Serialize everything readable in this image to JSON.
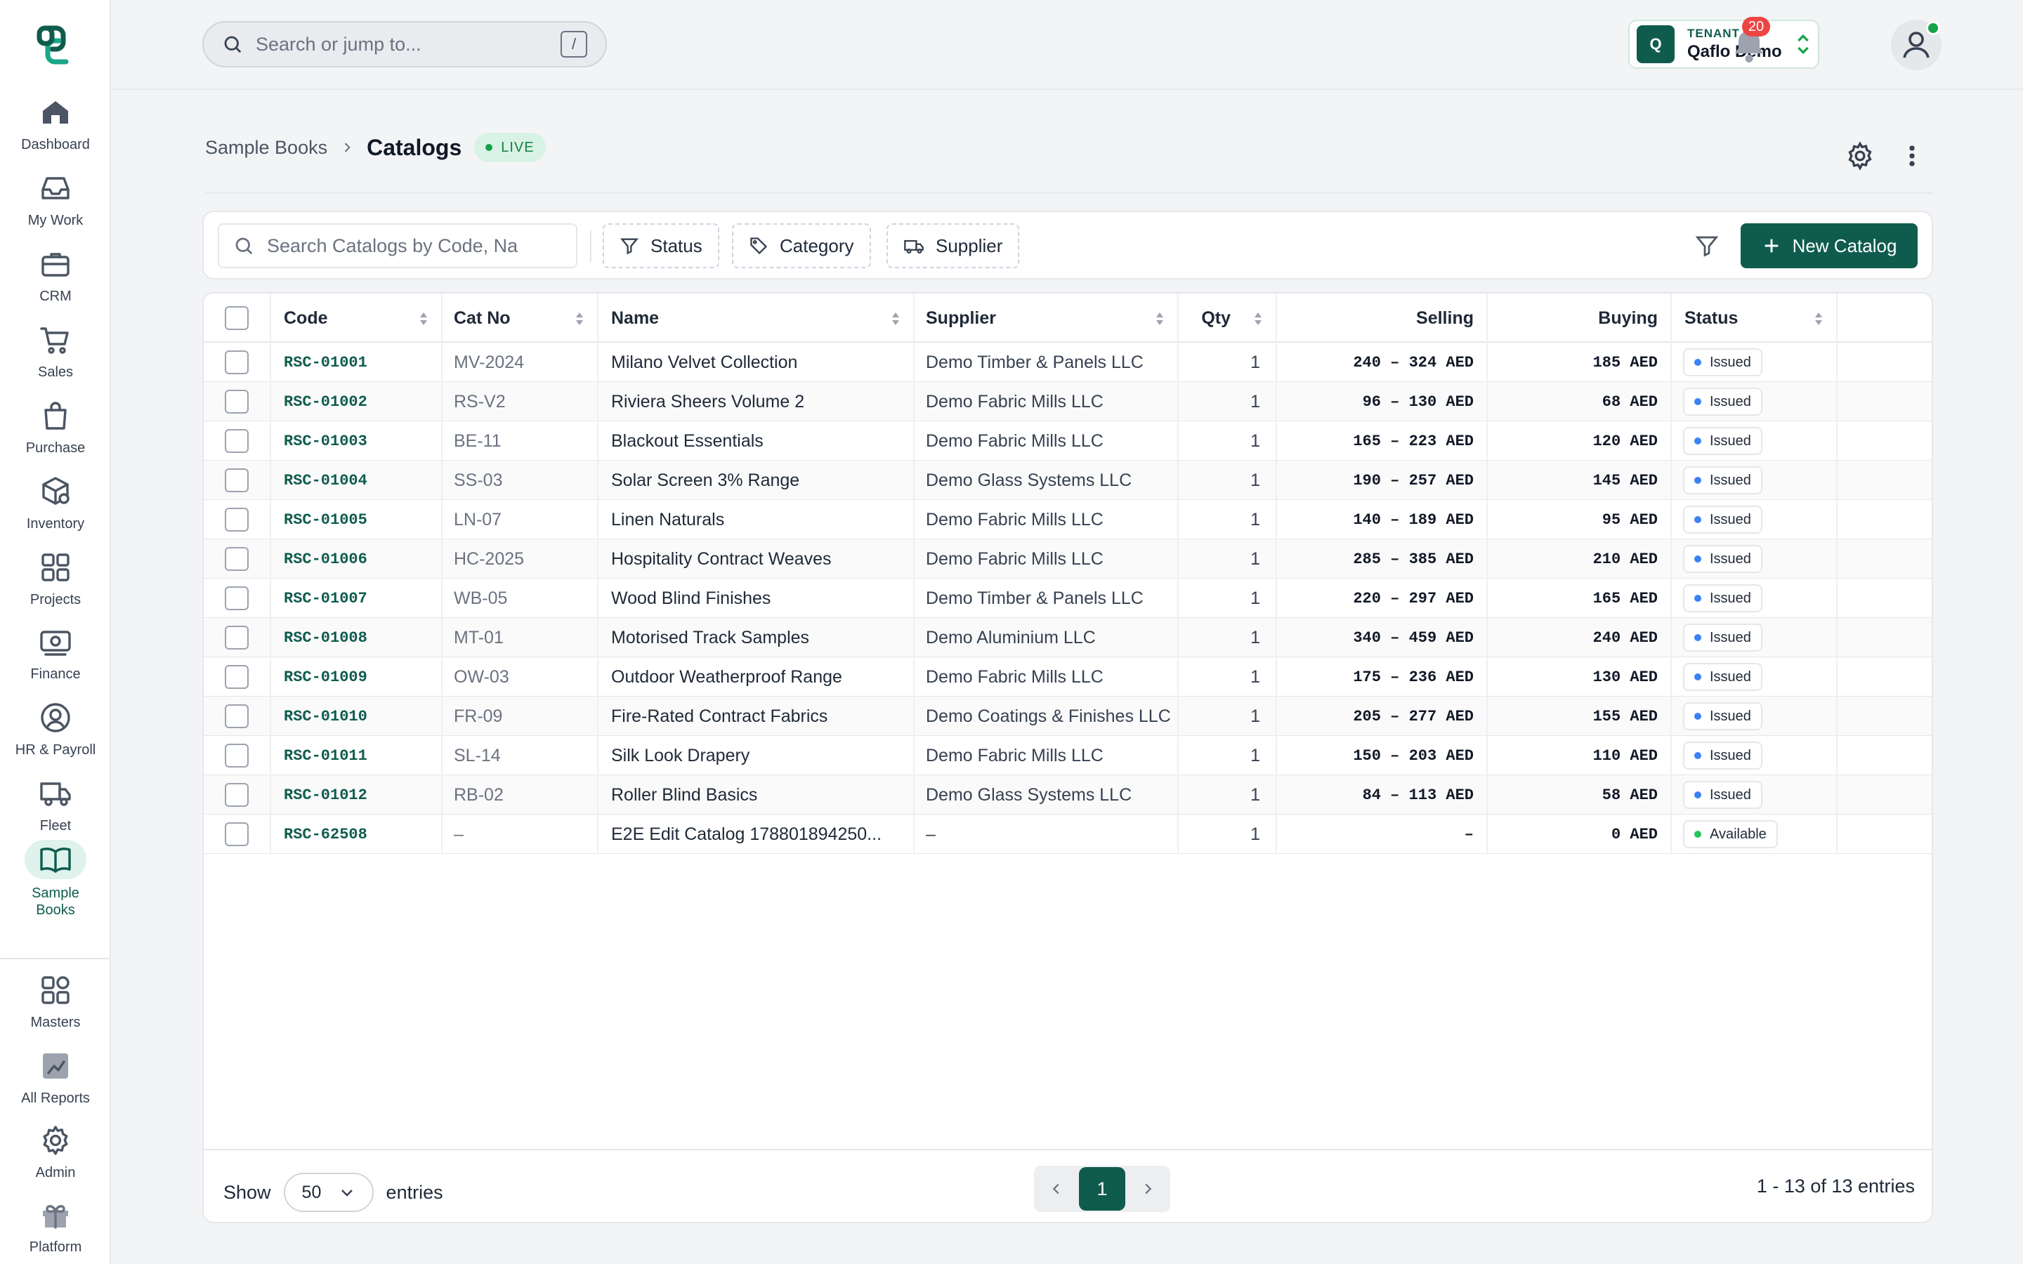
{
  "sidebar": {
    "items": [
      {
        "label": "Dashboard",
        "icon": "home-icon"
      },
      {
        "label": "My Work",
        "icon": "inbox-icon"
      },
      {
        "label": "CRM",
        "icon": "briefcase-icon"
      },
      {
        "label": "Sales",
        "icon": "cart-icon"
      },
      {
        "label": "Purchase",
        "icon": "shopping-bag-icon"
      },
      {
        "label": "Inventory",
        "icon": "package-icon"
      },
      {
        "label": "Projects",
        "icon": "grid-icon"
      },
      {
        "label": "Finance",
        "icon": "banknote-icon"
      },
      {
        "label": "HR & Payroll",
        "icon": "user-circle-icon"
      },
      {
        "label": "Fleet",
        "icon": "truck-icon"
      },
      {
        "label": "Sample\nBooks",
        "icon": "book-open-icon",
        "active": true
      }
    ],
    "bottom_items": [
      {
        "label": "Masters",
        "icon": "apps-icon"
      },
      {
        "label": "All Reports",
        "icon": "chart-icon"
      },
      {
        "label": "Admin",
        "icon": "gear-icon"
      },
      {
        "label": "Platform",
        "icon": "gift-icon"
      }
    ]
  },
  "topbar": {
    "search_placeholder": "Search or jump to...",
    "shortcut": "/",
    "tenant_label": "TENANT",
    "tenant_name": "Qaflo Demo",
    "tenant_initial": "Q",
    "notifications_count": "20"
  },
  "page": {
    "breadcrumb_parent": "Sample Books",
    "title": "Catalogs",
    "status_badge": "LIVE"
  },
  "filters": {
    "search_placeholder": "Search Catalogs by Code, Na",
    "status_label": "Status",
    "category_label": "Category",
    "supplier_label": "Supplier",
    "new_button_label": "New Catalog"
  },
  "table": {
    "columns": [
      "Code",
      "Cat No",
      "Name",
      "Supplier",
      "Qty",
      "Selling",
      "Buying",
      "Status"
    ],
    "rows": [
      {
        "code": "RSC-01001",
        "cat_no": "MV-2024",
        "name": "Milano Velvet Collection",
        "supplier": "Demo Timber & Panels LLC",
        "qty": "1",
        "selling": "240 – 324 AED",
        "buying": "185 AED",
        "status": "Issued"
      },
      {
        "code": "RSC-01002",
        "cat_no": "RS-V2",
        "name": "Riviera Sheers Volume 2",
        "supplier": "Demo Fabric Mills LLC",
        "qty": "1",
        "selling": "96 – 130 AED",
        "buying": "68 AED",
        "status": "Issued"
      },
      {
        "code": "RSC-01003",
        "cat_no": "BE-11",
        "name": "Blackout Essentials",
        "supplier": "Demo Fabric Mills LLC",
        "qty": "1",
        "selling": "165 – 223 AED",
        "buying": "120 AED",
        "status": "Issued"
      },
      {
        "code": "RSC-01004",
        "cat_no": "SS-03",
        "name": "Solar Screen 3% Range",
        "supplier": "Demo Glass Systems LLC",
        "qty": "1",
        "selling": "190 – 257 AED",
        "buying": "145 AED",
        "status": "Issued"
      },
      {
        "code": "RSC-01005",
        "cat_no": "LN-07",
        "name": "Linen Naturals",
        "supplier": "Demo Fabric Mills LLC",
        "qty": "1",
        "selling": "140 – 189 AED",
        "buying": "95 AED",
        "status": "Issued"
      },
      {
        "code": "RSC-01006",
        "cat_no": "HC-2025",
        "name": "Hospitality Contract Weaves",
        "supplier": "Demo Fabric Mills LLC",
        "qty": "1",
        "selling": "285 – 385 AED",
        "buying": "210 AED",
        "status": "Issued"
      },
      {
        "code": "RSC-01007",
        "cat_no": "WB-05",
        "name": "Wood Blind Finishes",
        "supplier": "Demo Timber & Panels LLC",
        "qty": "1",
        "selling": "220 – 297 AED",
        "buying": "165 AED",
        "status": "Issued"
      },
      {
        "code": "RSC-01008",
        "cat_no": "MT-01",
        "name": "Motorised Track Samples",
        "supplier": "Demo Aluminium LLC",
        "qty": "1",
        "selling": "340 – 459 AED",
        "buying": "240 AED",
        "status": "Issued"
      },
      {
        "code": "RSC-01009",
        "cat_no": "OW-03",
        "name": "Outdoor Weatherproof Range",
        "supplier": "Demo Fabric Mills LLC",
        "qty": "1",
        "selling": "175 – 236 AED",
        "buying": "130 AED",
        "status": "Issued"
      },
      {
        "code": "RSC-01010",
        "cat_no": "FR-09",
        "name": "Fire-Rated Contract Fabrics",
        "supplier": "Demo Coatings & Finishes LLC",
        "qty": "1",
        "selling": "205 – 277 AED",
        "buying": "155 AED",
        "status": "Issued"
      },
      {
        "code": "RSC-01011",
        "cat_no": "SL-14",
        "name": "Silk Look Drapery",
        "supplier": "Demo Fabric Mills LLC",
        "qty": "1",
        "selling": "150 – 203 AED",
        "buying": "110 AED",
        "status": "Issued"
      },
      {
        "code": "RSC-01012",
        "cat_no": "RB-02",
        "name": "Roller Blind Basics",
        "supplier": "Demo Glass Systems LLC",
        "qty": "1",
        "selling": "84 – 113 AED",
        "buying": "58 AED",
        "status": "Issued"
      },
      {
        "code": "RSC-62508",
        "cat_no": "–",
        "name": "E2E Edit Catalog 178801894250...",
        "supplier": "–",
        "qty": "1",
        "selling": "–",
        "buying": "0 AED",
        "status": "Available"
      }
    ]
  },
  "footer": {
    "show_label": "Show",
    "page_size": "50",
    "entries_label": "entries",
    "current_page": "1",
    "count_text": "1 - 13 of 13 entries"
  },
  "colors": {
    "brand": "#0f5c4e",
    "issued_dot": "#3b82f6",
    "available_dot": "#22c55e",
    "badge_red": "#ef4444"
  }
}
